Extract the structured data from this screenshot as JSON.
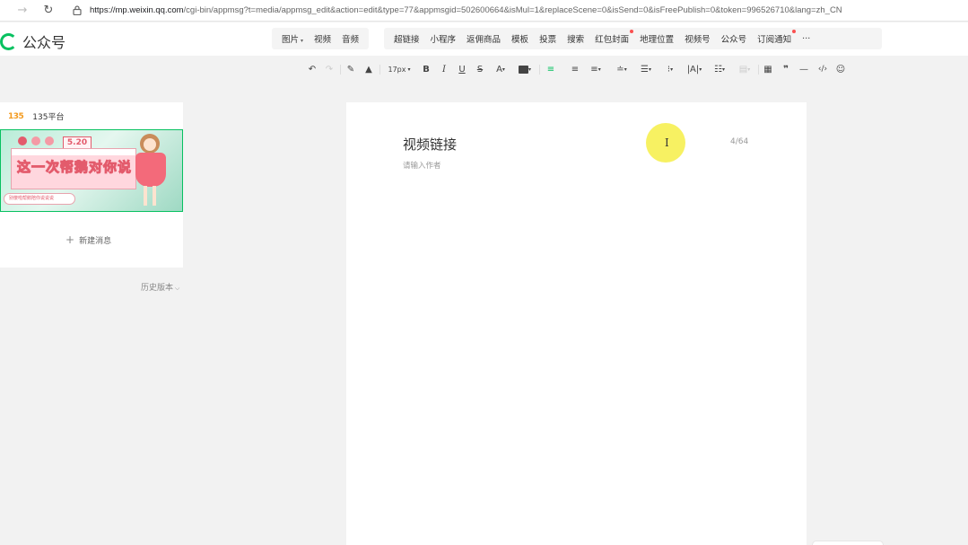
{
  "browser": {
    "url_host": "https://mp.weixin.qq.com",
    "url_path": "/cgi-bin/appmsg?t=media/appmsg_edit&action=edit&type=77&appmsgid=502600664&isMul=1&replaceScene=0&isSend=0&isFreePublish=0&token=996526710&lang=zh_CN"
  },
  "app": {
    "logo_text": "公众号"
  },
  "insert_menu": {
    "group1": [
      {
        "label": "图片",
        "caret": "▾"
      },
      {
        "label": "视频"
      },
      {
        "label": "音频"
      }
    ],
    "group2": [
      {
        "label": "超链接"
      },
      {
        "label": "小程序"
      },
      {
        "label": "返佣商品"
      },
      {
        "label": "模板"
      },
      {
        "label": "投票"
      },
      {
        "label": "搜索"
      },
      {
        "label": "红包封面",
        "dot": true
      },
      {
        "label": "地理位置"
      },
      {
        "label": "视频号"
      },
      {
        "label": "公众号"
      },
      {
        "label": "订阅通知",
        "dot": true
      },
      {
        "label": "···"
      }
    ]
  },
  "toolbar": {
    "font_size": "17px"
  },
  "sidebar": {
    "account_logo": "135",
    "account_name": "135平台",
    "cover_badge": "5.20",
    "cover_headline": "这一次帮鹅对你说",
    "cover_subline": "别傻啦帮鹅陪你说说说",
    "new_message_label": "新建消息",
    "history_label": "历史版本"
  },
  "editor": {
    "title": "视频链接",
    "title_count": "4/64",
    "author_placeholder": "请输入作者"
  },
  "colors": {
    "brand_green": "#07c160",
    "notice_red": "#fa5151",
    "cursor_highlight": "#f7f05a"
  }
}
